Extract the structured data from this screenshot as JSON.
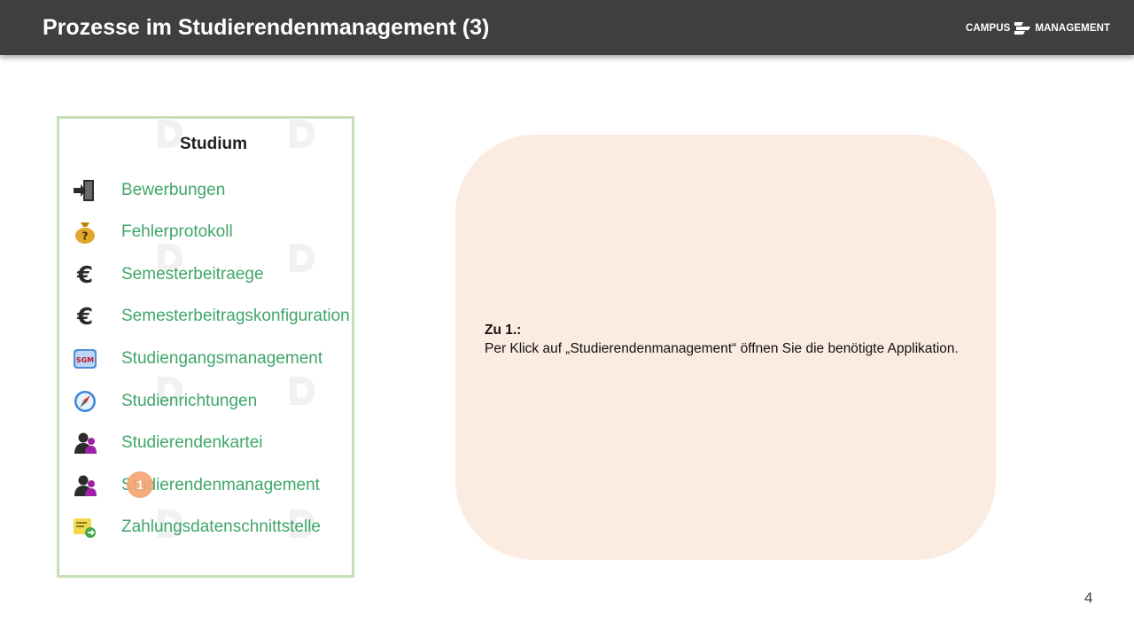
{
  "header": {
    "title": "Prozesse im Studierendenmanagement (3)",
    "logo": {
      "left": "CAMPUS",
      "right": "MANAGEMENT"
    }
  },
  "panel": {
    "title": "Studium",
    "items": [
      {
        "label": "Bewerbungen",
        "icon": "door-enter-icon"
      },
      {
        "label": "Fehlerprotokoll",
        "icon": "money-bag-icon"
      },
      {
        "label": "Semesterbeitraege",
        "icon": "euro-icon"
      },
      {
        "label": "Semesterbeitragskonfiguration",
        "icon": "euro-icon"
      },
      {
        "label": "Studiengangsmanagement",
        "icon": "sgm-badge-icon"
      },
      {
        "label": "Studienrichtungen",
        "icon": "compass-icon"
      },
      {
        "label": "Studierendenkartei",
        "icon": "user-icon"
      },
      {
        "label": "Studierendenmanagement",
        "icon": "user-icon"
      },
      {
        "label": "Zahlungsdatenschnittstelle",
        "icon": "certificate-icon"
      }
    ]
  },
  "marker": {
    "label": "1"
  },
  "callout": {
    "heading": "Zu 1.:",
    "body": "Per Klick auf „Studierendenmanagement“ öffnen Sie die benötigte Applikation."
  },
  "sgm_badge_text": "SGM",
  "page_number": "4",
  "colors": {
    "header_bg": "#3f3f3f",
    "panel_border": "#c5dfb6",
    "link_green": "#3fa66a",
    "marker": "#f3a472",
    "callout_bg": "#fbebe1"
  }
}
